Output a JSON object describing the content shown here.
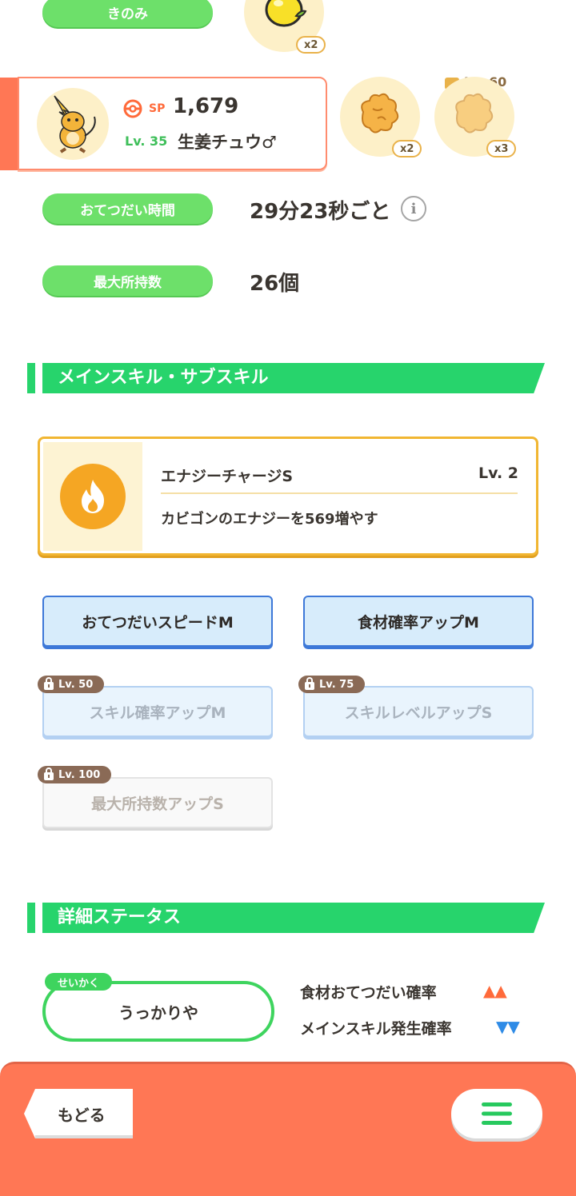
{
  "berry_label": "きのみ",
  "berry_qty": "x2",
  "profile": {
    "sp_label": "SP",
    "sp_value": "1,679",
    "level_label": "Lv. 35",
    "name": "生姜チュウ♂"
  },
  "ingredients": [
    {
      "qty": "x2"
    },
    {
      "qty": "x3",
      "lock_label": "Lv. 60"
    }
  ],
  "help_time": {
    "label": "おてつだい時間",
    "value": "29分23秒ごと"
  },
  "max_carry": {
    "label": "最大所持数",
    "value": "26個"
  },
  "skill_section_title": "メインスキル・サブスキル",
  "main_skill": {
    "name": "エナジーチャージS",
    "level": "Lv. 2",
    "description": "カビゴンのエナジーを569増やす",
    "icon": "flame-icon",
    "color": "#f5a623"
  },
  "sub_skills": [
    {
      "label": "おてつだいスピードM"
    },
    {
      "label": "食材確率アップM"
    },
    {
      "label": "スキル確率アップM",
      "lock_level": "Lv. 50"
    },
    {
      "label": "スキルレベルアップS",
      "lock_level": "Lv. 75"
    },
    {
      "label": "最大所持数アップS",
      "lock_level": "Lv. 100"
    }
  ],
  "detail_section_title": "詳細ステータス",
  "nature": {
    "tag": "せいかく",
    "value": "うっかりや",
    "effects": [
      {
        "label": "食材おてつだい確率",
        "arrows": "▲▲",
        "color": "#ff6a3a"
      },
      {
        "label": "メインスキル発生確率",
        "arrows": "▼▼",
        "color": "#2f8be6"
      }
    ]
  },
  "footer": {
    "back_label": "もどる",
    "menu_icon": "hamburger-menu-icon",
    "bg_color": "#ff7755"
  }
}
